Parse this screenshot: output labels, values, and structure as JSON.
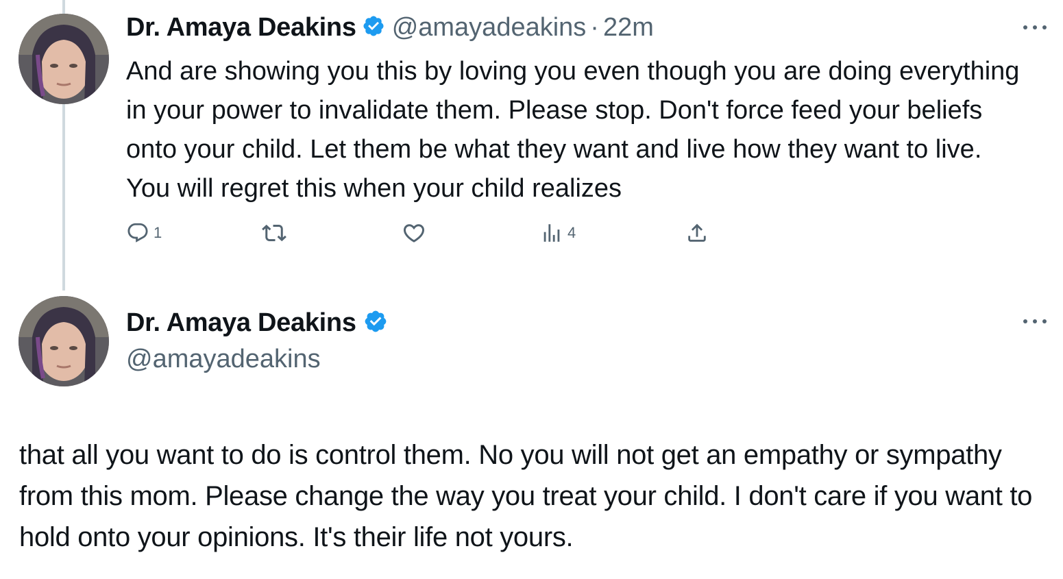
{
  "tweet1": {
    "author_name": "Dr. Amaya Deakins",
    "handle": "@amayadeakins",
    "separator": "·",
    "time": "22m",
    "text": "And are showing you this by loving you even though you are doing everything in your power to invalidate them. Please stop. Don't force feed your beliefs onto your child. Let them be what they want and live how they want to live. You will regret this when your child realizes",
    "actions": {
      "reply_icon": "reply-icon",
      "reply_count": "1",
      "retweet_icon": "retweet-icon",
      "like_icon": "heart-icon",
      "views_icon": "views-icon",
      "views_count": "4",
      "share_icon": "share-icon"
    }
  },
  "tweet2": {
    "author_name": "Dr. Amaya Deakins",
    "handle": "@amayadeakins",
    "text": "that all you want to do is control them. No you will not get an empathy or sympathy from this mom. Please change the way you treat your child. I don't care if you want to hold onto your opinions. It's their life not yours."
  },
  "colors": {
    "text": "#0f1419",
    "secondary": "#536471",
    "verified": "#1d9bf0",
    "thread_line": "#cfd9de"
  }
}
